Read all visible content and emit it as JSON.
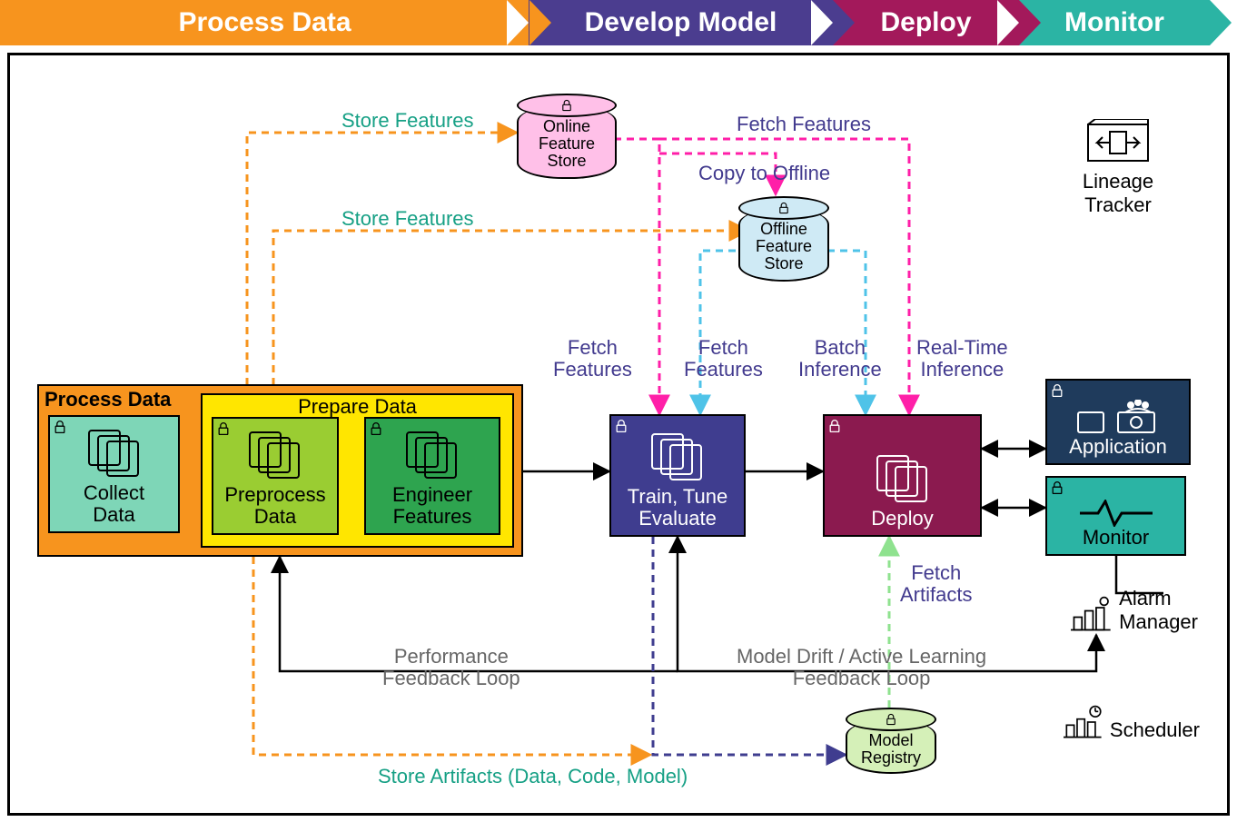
{
  "phases": {
    "process": "Process Data",
    "develop": "Develop Model",
    "deploy": "Deploy",
    "monitor": "Monitor"
  },
  "groups": {
    "process_data": "Process Data",
    "prepare_data": "Prepare Data"
  },
  "nodes": {
    "collect_data": "Collect\nData",
    "preprocess_data": "Preprocess\nData",
    "engineer_features": "Engineer\nFeatures",
    "train_tune_evaluate": "Train, Tune\nEvaluate",
    "deploy": "Deploy",
    "application": "Application",
    "monitor": "Monitor",
    "online_feature_store": "Online\nFeature\nStore",
    "offline_feature_store": "Offline\nFeature\nStore",
    "model_registry": "Model\nRegistry"
  },
  "edges": {
    "store_features_online": "Store Features",
    "store_features_offline": "Store Features",
    "fetch_features_top": "Fetch Features",
    "copy_to_offline": "Copy to Offline",
    "fetch_features_left": "Fetch\nFeatures",
    "fetch_features_right": "Fetch\nFeatures",
    "batch_inference": "Batch\nInference",
    "realtime_inference": "Real-Time\nInference",
    "fetch_artifacts": "Fetch\nArtifacts",
    "store_artifacts": "Store Artifacts (Data, Code, Model)",
    "perf_feedback": "Performance\nFeedback Loop",
    "drift_feedback": "Model Drift / Active Learning\nFeedback Loop"
  },
  "side": {
    "lineage_tracker": "Lineage\nTracker",
    "alarm_manager": "Alarm\nManager",
    "scheduler": "Scheduler"
  },
  "colors": {
    "orange": "#f7941e",
    "yellow": "#ffe600",
    "mint": "#7ed6b7",
    "lime": "#9acd32",
    "green": "#2ea44f",
    "indigo": "#3f3d8f",
    "maroon": "#8b1a4f",
    "teal": "#2bb4a4",
    "navy": "#1f3b5c",
    "pink": "#ffc0e8",
    "ltblue": "#cfeaf5",
    "ltgreen": "#d5f0b8"
  }
}
